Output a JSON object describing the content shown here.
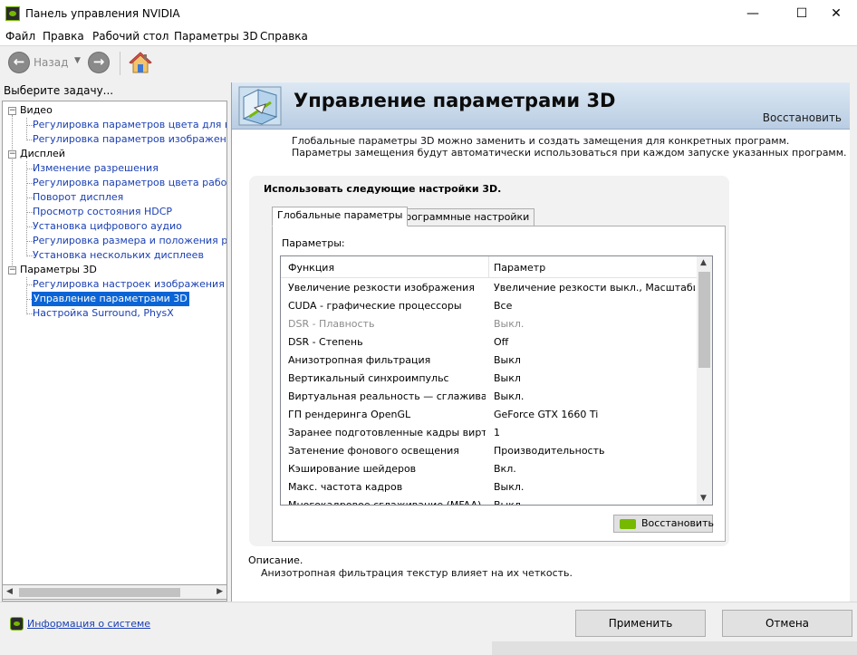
{
  "window": {
    "title": "Панель управления NVIDIA",
    "minimize": "—",
    "maximize": "☐",
    "close": "✕"
  },
  "menu": [
    "Файл",
    "Правка",
    "Рабочий стол",
    "Параметры 3D",
    "Справка"
  ],
  "toolbar": {
    "back_label": "Назад",
    "back_glyph": "←",
    "forward_glyph": "→",
    "dropdown_glyph": "▼"
  },
  "left": {
    "task_label": "Выберите задачу...",
    "categories": [
      {
        "label": "Видео",
        "items": [
          "Регулировка параметров цвета для видео",
          "Регулировка параметров изображения для видео"
        ]
      },
      {
        "label": "Дисплей",
        "items": [
          "Изменение разрешения",
          "Регулировка параметров цвета рабочего стола",
          "Поворот дисплея",
          "Просмотр состояния HDCP",
          "Установка цифрового аудио",
          "Регулировка размера и положения рабочего стола",
          "Установка нескольких дисплеев"
        ]
      },
      {
        "label": "Параметры 3D",
        "items": [
          "Регулировка настроек изображения с просмотром",
          "Управление параметрами 3D",
          "Настройка Surround, PhysX"
        ]
      }
    ],
    "selected_item": "Управление параметрами 3D"
  },
  "main": {
    "title": "Управление параметрами 3D",
    "restore_link": "Восстановить",
    "intro": "Глобальные параметры 3D можно заменить и создать замещения для конкретных программ. Параметры замещения будут автоматически использоваться при каждом запуске указанных программ.",
    "settings_heading": "Использовать следующие настройки 3D.",
    "tabs": [
      "Глобальные параметры",
      "Программные настройки"
    ],
    "active_tab": "Глобальные параметры",
    "params_label": "Параметры:",
    "table": {
      "columns": [
        "Функция",
        "Параметр"
      ],
      "rows": [
        {
          "name": "Увеличение резкости изображения",
          "value": "Увеличение резкости выкл., Масштабир...",
          "disabled": false
        },
        {
          "name": "CUDA - графические процессоры",
          "value": "Все",
          "disabled": false
        },
        {
          "name": "DSR - Плавность",
          "value": "Выкл.",
          "disabled": true
        },
        {
          "name": "DSR - Степень",
          "value": "Off",
          "disabled": false
        },
        {
          "name": "Анизотропная фильтрация",
          "value": "Выкл",
          "disabled": false
        },
        {
          "name": "Вертикальный синхроимпульс",
          "value": "Выкл",
          "disabled": false
        },
        {
          "name": "Виртуальная реальность — сглаживан...",
          "value": "Выкл.",
          "disabled": false
        },
        {
          "name": "ГП рендеринга OpenGL",
          "value": "GeForce GTX 1660 Ti",
          "disabled": false
        },
        {
          "name": "Заранее подготовленные кадры вирту...",
          "value": "1",
          "disabled": false
        },
        {
          "name": "Затенение фонового освещения",
          "value": "Производительность",
          "disabled": false
        },
        {
          "name": "Кэширование шейдеров",
          "value": "Вкл.",
          "disabled": false
        },
        {
          "name": "Макс. частота кадров",
          "value": "Выкл.",
          "disabled": false
        },
        {
          "name": "Многокадровое сглаживание (MFAA)",
          "value": "Выкл.",
          "disabled": false
        }
      ]
    },
    "restore_button": "Восстановить",
    "description_label": "Описание.",
    "description_text": "Анизотропная фильтрация текстур влияет на их четкость."
  },
  "footer": {
    "sysinfo_link": "Информация о системе",
    "apply_button": "Применить",
    "cancel_button": "Отмена"
  },
  "colors": {
    "nvidia_green": "#76b900",
    "link_blue": "#1a3fb3",
    "selection_blue": "#0a64d6"
  }
}
